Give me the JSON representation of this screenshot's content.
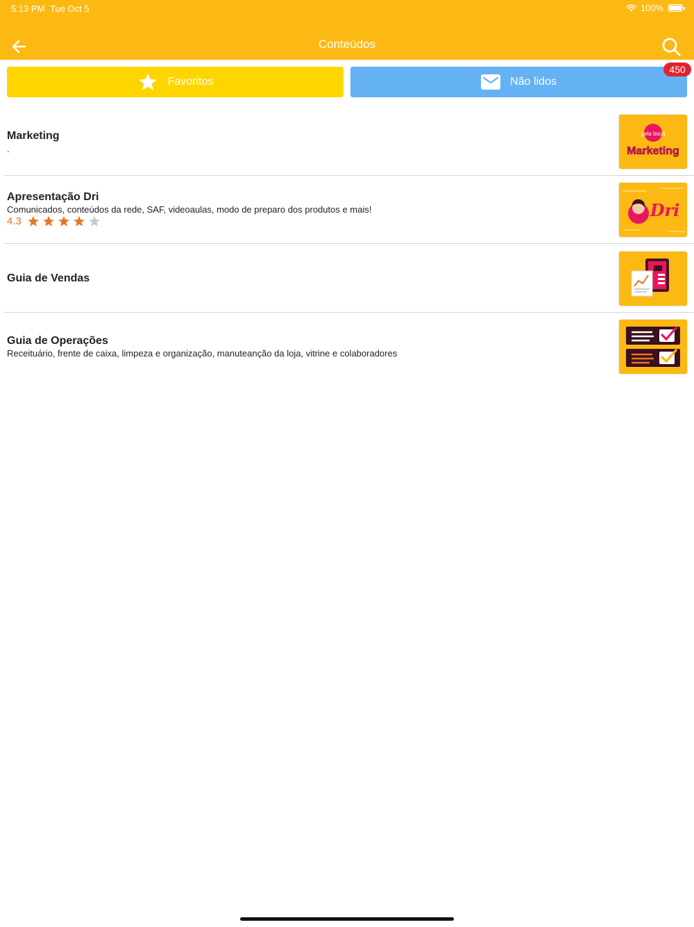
{
  "status_bar": {
    "time": "5:13 PM",
    "date": "Tue Oct 5",
    "battery": "100%"
  },
  "header": {
    "title": "Conteúdos",
    "back_icon": "arrow-left-icon",
    "search_icon": "search-icon"
  },
  "tabs": {
    "favorites_label": "Favoritos",
    "unread_label": "Não lidos",
    "unread_count": "450"
  },
  "items": [
    {
      "title": "Marketing",
      "subtitle": ".",
      "thumb_label": "Marketing",
      "thumb_brand": "gela boca"
    },
    {
      "title": "Apresentação Dri",
      "subtitle": "Comunicados, conteúdos da rede, SAF, videoaulas, modo de preparo dos produtos e mais!",
      "rating": "4.3",
      "rating_value": 4.3,
      "rating_max": 5,
      "thumb_label": "Dri"
    },
    {
      "title": "Guia de Vendas",
      "subtitle": ""
    },
    {
      "title": "Guia de Operações",
      "subtitle": "Receituário, frente de caixa, limpeza e organização, manuteanção da loja, vitrine e colaboradores"
    }
  ],
  "colors": {
    "appbar": "#FDB913",
    "favorites_tab": "#FFD500",
    "unread_tab": "#64B2F4",
    "badge": "#E0232F",
    "rating": "#E87722"
  }
}
